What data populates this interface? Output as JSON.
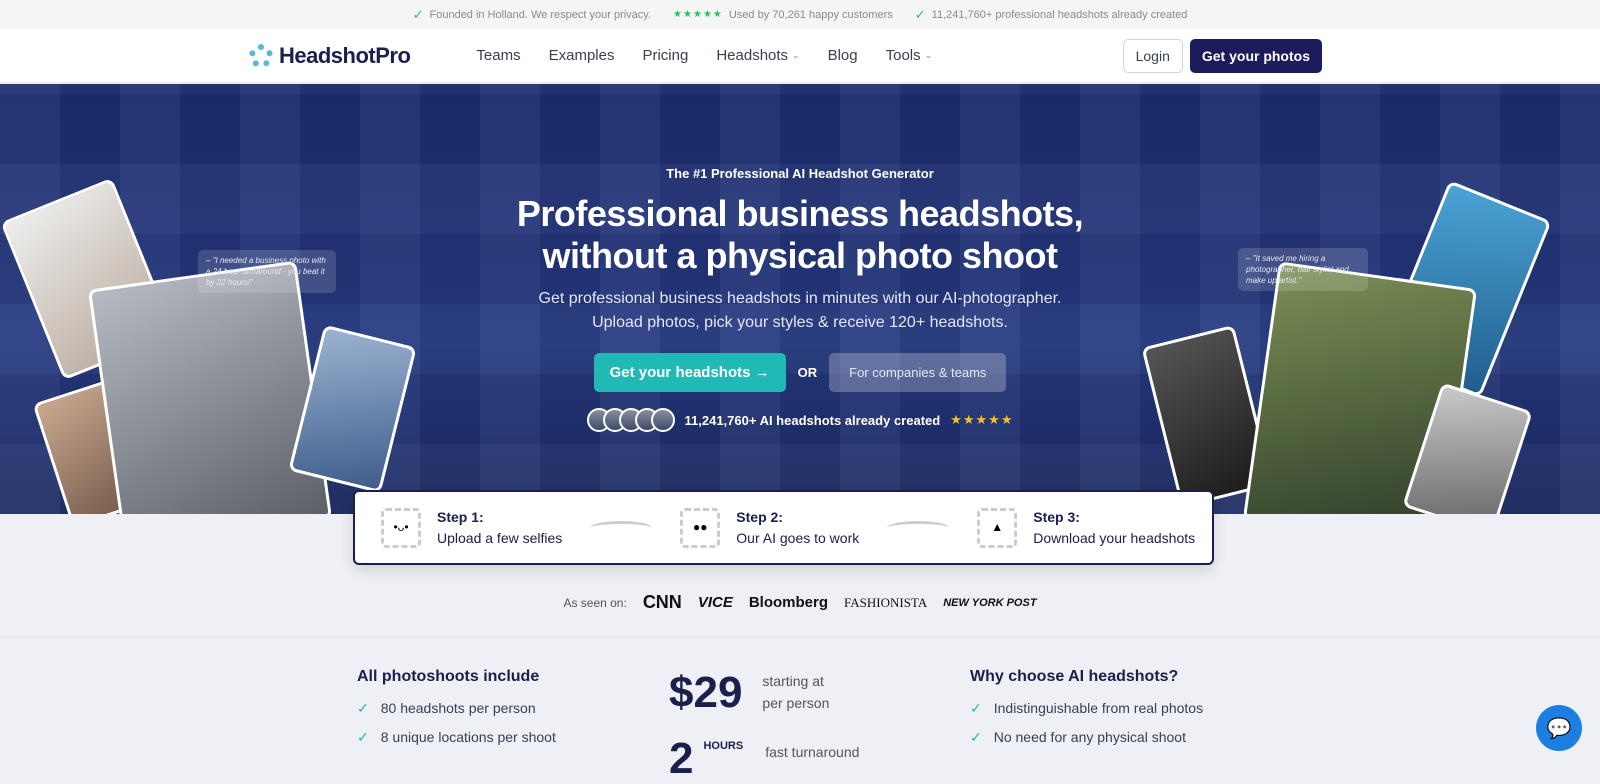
{
  "topbar": {
    "items": [
      "Founded in Holland. We respect your privacy.",
      "Used by 70,261 happy customers",
      "11,241,760+ professional headshots already created"
    ],
    "stars": "★★★★★"
  },
  "nav": {
    "logo": "HeadshotPro",
    "menu": [
      "Teams",
      "Examples",
      "Pricing",
      "Headshots",
      "Blog",
      "Tools"
    ],
    "login": "Login",
    "cta": "Get your photos"
  },
  "hero": {
    "eyebrow": "The #1 Professional AI Headshot Generator",
    "title_line1": "Professional business headshots,",
    "title_line2": "without a physical photo shoot",
    "sub_line1": "Get professional business headshots in minutes with our AI-photographer.",
    "sub_line2": "Upload photos, pick your styles & receive 120+ headshots.",
    "cta_primary": "Get your headshots",
    "cta_arrow": "→",
    "or": "OR",
    "cta_secondary": "For companies & teams",
    "social_proof": "11,241,760+ AI headshots already created",
    "stars": "★★★★★",
    "quote_left": "– \"I needed a business photo with a 24 hour turnaround - you beat it by 22 hours!\"",
    "quote_right": "– \"It saved me hiring a photographer, hair stylist and make up artist.\""
  },
  "steps": [
    {
      "title": "Step 1:",
      "text": "Upload a few selfies"
    },
    {
      "title": "Step 2:",
      "text": "Our AI goes to work"
    },
    {
      "title": "Step 3:",
      "text": "Download your headshots"
    }
  ],
  "seen": {
    "label": "As seen on:",
    "brands": [
      "CNN",
      "VICE",
      "Bloomberg",
      "FASHIONISTA",
      "NEW YORK POST"
    ]
  },
  "features": {
    "left_title": "All photoshoots include",
    "left_items": [
      "80 headshots per person",
      "8 unique locations per shoot"
    ],
    "price": "$29",
    "price_text1": "starting at",
    "price_text2": "per person",
    "hours_num": "2",
    "hours_label": "HOURS",
    "hours_text": "fast turnaround",
    "right_title": "Why choose AI headshots?",
    "right_items": [
      "Indistinguishable from real photos",
      "No need for any physical shoot"
    ]
  },
  "colors": {
    "accent": "#20b9b6",
    "navy": "#1b1b5e",
    "hero": "#24377c"
  }
}
